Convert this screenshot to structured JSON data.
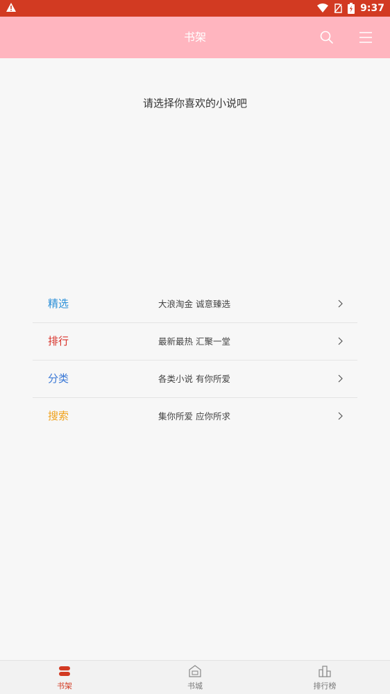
{
  "status_bar": {
    "time": "9:37"
  },
  "header": {
    "title": "书架"
  },
  "prompt": "请选择你喜欢的小说吧",
  "menu": [
    {
      "label": "精选",
      "desc": "大浪淘金  诚意臻选",
      "color": "#2a8fd8"
    },
    {
      "label": "排行",
      "desc": "最新最热  汇聚一堂",
      "color": "#d8322a"
    },
    {
      "label": "分类",
      "desc": "各类小说  有你所爱",
      "color": "#3a78d6"
    },
    {
      "label": "搜索",
      "desc": "集你所爱  应你所求",
      "color": "#f0a21c"
    }
  ],
  "bottom_nav": [
    {
      "label": "书架",
      "icon": "bookshelf-icon",
      "active": true
    },
    {
      "label": "书城",
      "icon": "bookstore-icon",
      "active": false
    },
    {
      "label": "排行榜",
      "icon": "ranking-icon",
      "active": false
    }
  ],
  "colors": {
    "accent": "#d23a22",
    "header_bg": "#ffb5bf",
    "inactive": "#888888"
  }
}
